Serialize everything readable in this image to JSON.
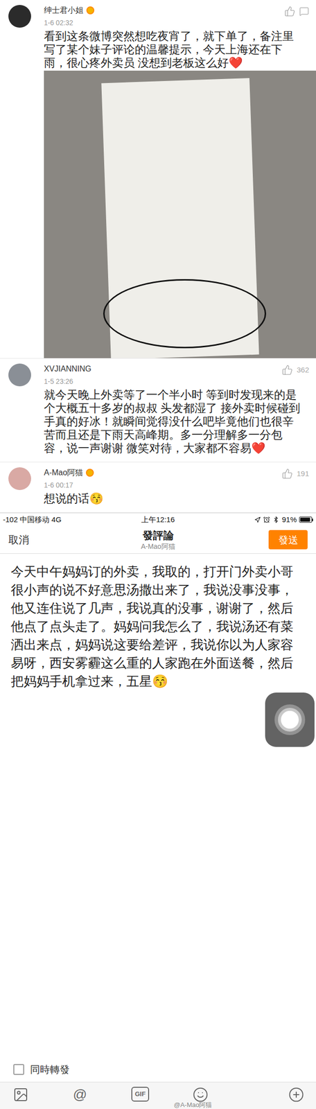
{
  "comments": [
    {
      "name": "绅士君小姐",
      "verified": true,
      "time": "1-6 02:32",
      "likes": null,
      "text": "看到这条微博突然想吃夜宵了，就下单了，备注里写了某个妹子评论的温馨提示，今天上海还在下雨，很心疼外卖员 没想到老板这么好❤️",
      "has_photo": true,
      "color": "#2b2b2b"
    },
    {
      "name": "XVJIANNING",
      "verified": false,
      "time": "1-5 23:26",
      "likes": "362",
      "text": "就今天晚上外卖等了一个半小时 等到时发现来的是个大概五十多岁的叔叔 头发都湿了 接外卖时候碰到手真的好冰！就瞬间觉得没什么吧毕竟他们也很辛苦而且还是下雨天高峰期。多一分理解多一分包容，说一声谢谢 微笑对待，大家都不容易❤️",
      "has_photo": false,
      "color": "#8a8f96"
    },
    {
      "name": "A-Mao阿猫",
      "verified": true,
      "time": "1-6 00:17",
      "likes": "191",
      "text": "想说的话😚",
      "has_photo": false,
      "color": "#d9a9a4"
    }
  ],
  "compose": {
    "status_bar": {
      "carrier": "-102 中国移动 4G",
      "time": "上午12:16",
      "battery": "91%",
      "battery_level": 0.91
    },
    "cancel": "取消",
    "title": "發評論",
    "subtitle": "A-Mao阿猫",
    "send": "發送",
    "text": "今天中午妈妈订的外卖，我取的，打开门外卖小哥很小声的说不好意思汤撒出来了，我说没事没事，他又连住说了几声，我说真的没事，谢谢了，然后他点了点头走了。妈妈问我怎么了，我说汤还有菜洒出来点，妈妈说这要给差评，我说你以为人家容易呀，西安雾霾这么重的人家跑在外面送餐，然后把妈妈手机拿过来，五星😚",
    "repost": {
      "label": "同時轉發",
      "checked": false
    },
    "toolbar": [
      {
        "kind": "image"
      },
      {
        "kind": "text",
        "label": "@"
      },
      {
        "kind": "gif",
        "label": "GIF"
      },
      {
        "kind": "emoji"
      },
      {
        "kind": "plus"
      }
    ],
    "watermark": "@A-Mao阿猫"
  }
}
